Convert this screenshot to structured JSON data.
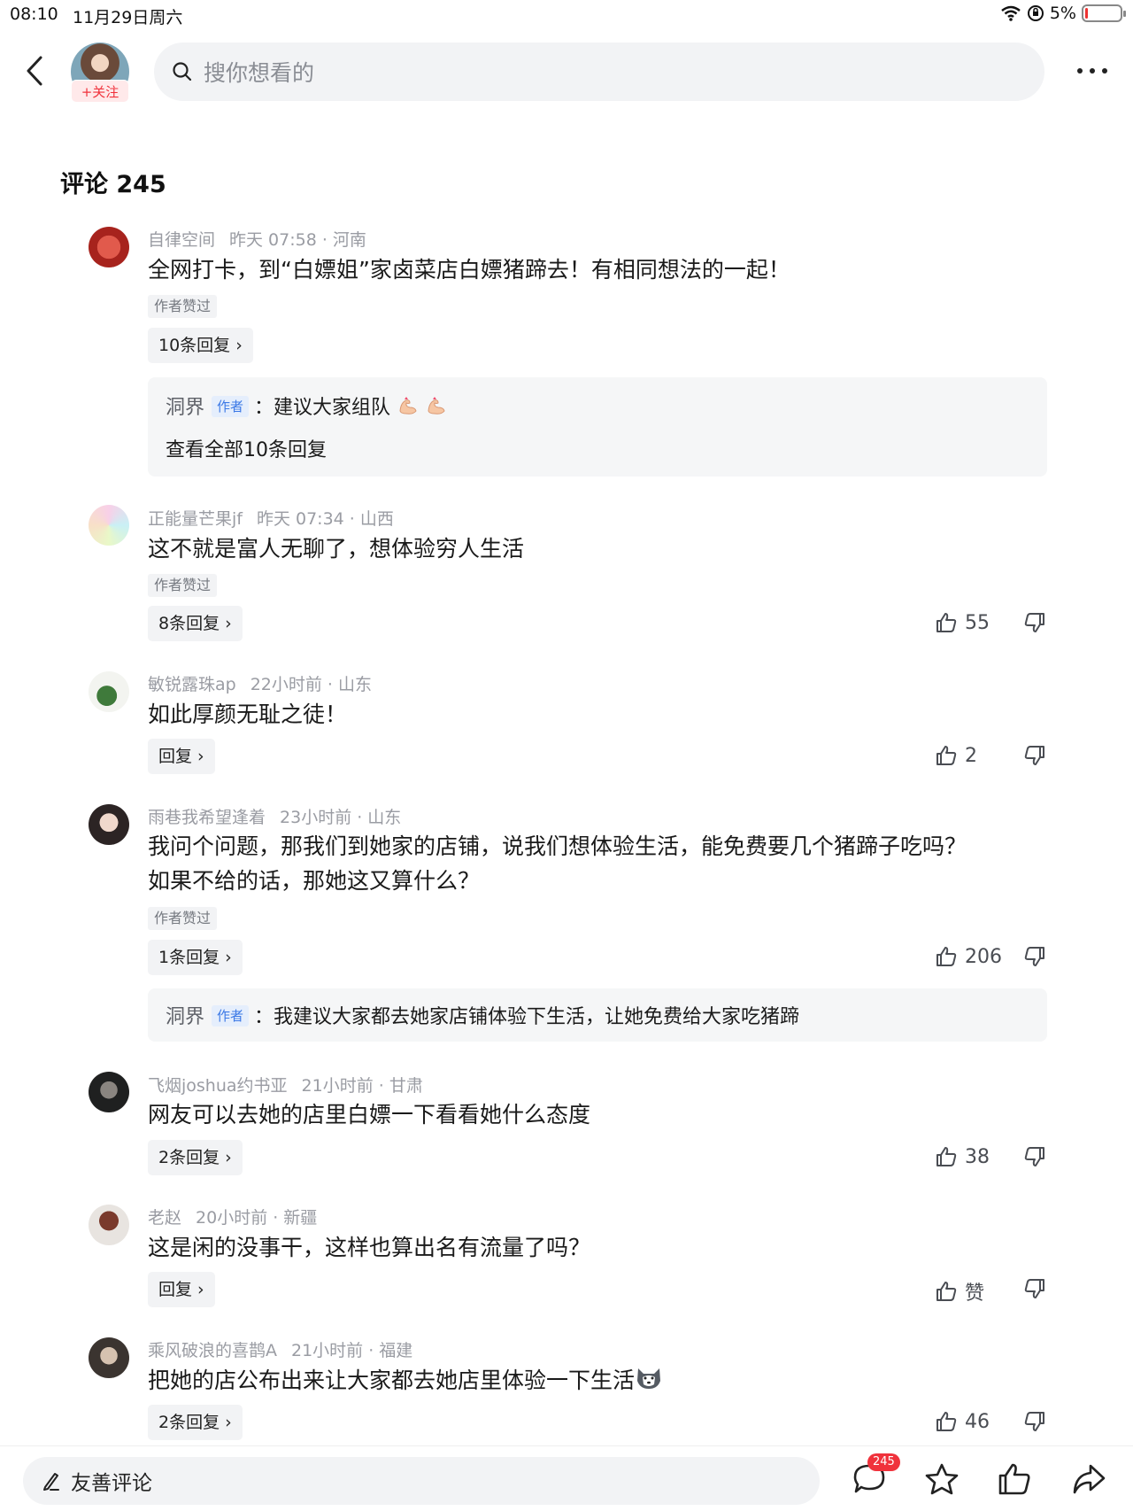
{
  "status": {
    "time": "08:10",
    "date": "11月29日周六",
    "battery": "5%"
  },
  "header": {
    "follow_label": "+关注",
    "search_placeholder": "搜你想看的"
  },
  "comments_title": "评论 245",
  "comments": [
    {
      "user": "自律空间",
      "time": "昨天 07:58 · 河南",
      "text": "全网打卡，到“白嫖姐”家卤菜店白嫖猪蹄去！有相同想法的一起！",
      "liked_tag": "作者赞过",
      "replies_label": "10条回复",
      "reply": {
        "name": "洞界",
        "tag": "作者",
        "text": "：建议大家组队",
        "view_all": "查看全部10条回复"
      }
    },
    {
      "user": "正能量芒果jf",
      "time": "昨天 07:34 · 山西",
      "text": "这不就是富人无聊了，想体验穷人生活",
      "liked_tag": "作者赞过",
      "replies_label": "8条回复",
      "likes": "55"
    },
    {
      "user": "敏锐露珠ap",
      "time": "22小时前 · 山东",
      "text": "如此厚颜无耻之徒！",
      "replies_label": "回复",
      "likes": "2"
    },
    {
      "user": "雨巷我希望逢着",
      "time": "23小时前 · 山东",
      "text_line1": "我问个问题，那我们到她家的店铺，说我们想体验生活，能免费要几个猪蹄子吃吗？",
      "text_line2": "如果不给的话，那她这又算什么？",
      "liked_tag": "作者赞过",
      "replies_label": "1条回复",
      "likes": "206",
      "reply": {
        "name": "洞界",
        "tag": "作者",
        "text": "：我建议大家都去她家店铺体验下生活，让她免费给大家吃猪蹄"
      }
    },
    {
      "user": "飞烟joshua约书亚",
      "time": "21小时前 · 甘肃",
      "text": "网友可以去她的店里白嫖一下看看她什么态度",
      "replies_label": "2条回复",
      "likes": "38"
    },
    {
      "user": "老赵",
      "time": "20小时前 · 新疆",
      "text": "这是闲的没事干，这样也算出名有流量了吗？",
      "replies_label": "回复",
      "likes": "赞"
    },
    {
      "user": "乘风破浪的喜鹊A",
      "time": "21小时前 · 福建",
      "text": "把她的店公布出来让大家都去她店里体验一下生活",
      "replies_label": "2条回复",
      "likes": "46"
    }
  ],
  "bottom": {
    "input_placeholder": "友善评论",
    "comment_count": "245"
  }
}
